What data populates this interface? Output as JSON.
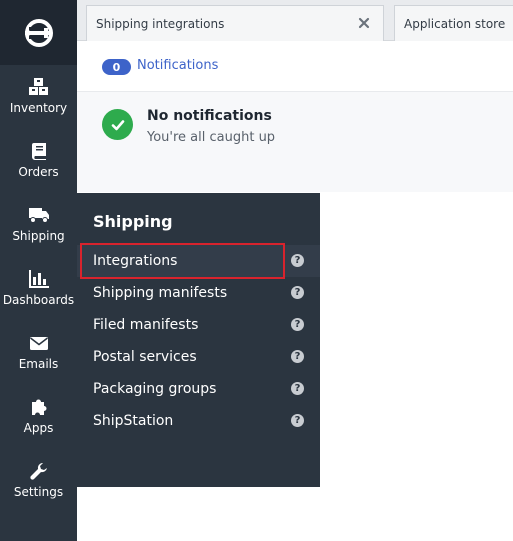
{
  "sidebar": {
    "items": [
      {
        "label": "Inventory",
        "icon": "boxes-icon"
      },
      {
        "label": "Orders",
        "icon": "book-icon"
      },
      {
        "label": "Shipping",
        "icon": "truck-icon"
      },
      {
        "label": "Dashboards",
        "icon": "bar-chart-icon"
      },
      {
        "label": "Emails",
        "icon": "envelope-icon"
      },
      {
        "label": "Apps",
        "icon": "puzzle-icon"
      },
      {
        "label": "Settings",
        "icon": "wrench-icon"
      }
    ]
  },
  "tabs": [
    {
      "label": "Shipping integrations",
      "active": true
    },
    {
      "label": "Application store",
      "active": false
    }
  ],
  "notifications": {
    "count": "0",
    "link_label": "Notifications",
    "empty_title": "No notifications",
    "empty_subtitle": "You're all caught up"
  },
  "flyout": {
    "title": "Shipping",
    "items": [
      {
        "label": "Integrations",
        "help": "?"
      },
      {
        "label": "Shipping manifests",
        "help": "?"
      },
      {
        "label": "Filed manifests",
        "help": "?"
      },
      {
        "label": "Postal services",
        "help": "?"
      },
      {
        "label": "Packaging groups",
        "help": "?"
      },
      {
        "label": "ShipStation",
        "help": "?"
      }
    ]
  },
  "colors": {
    "sidebar_bg": "#2b3540",
    "accent_blue": "#3d63c9",
    "success_green": "#2eab4d",
    "highlight_red": "#d9232d"
  }
}
